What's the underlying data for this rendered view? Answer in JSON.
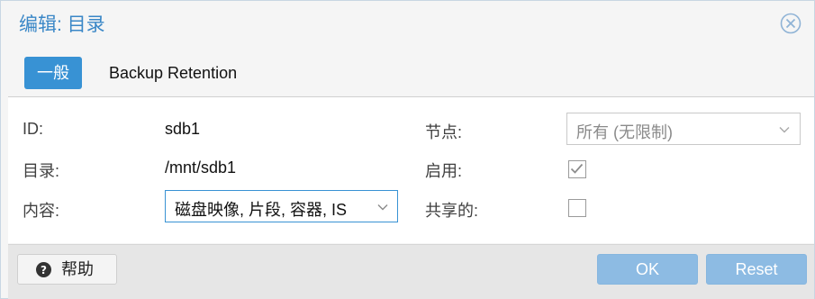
{
  "dialog": {
    "title": "编辑: 目录",
    "close_icon": "close-icon"
  },
  "tabs": [
    {
      "label": "一般",
      "active": true
    },
    {
      "label": "Backup Retention",
      "active": false
    }
  ],
  "form": {
    "id": {
      "label": "ID:",
      "value": "sdb1"
    },
    "directory": {
      "label": "目录:",
      "value": "/mnt/sdb1"
    },
    "content": {
      "label": "内容:",
      "value": "磁盘映像, 片段, 容器, IS"
    },
    "nodes": {
      "label": "节点:",
      "value": "所有 (无限制)"
    },
    "enabled": {
      "label": "启用:",
      "checked": true
    },
    "shared": {
      "label": "共享的:",
      "checked": false
    }
  },
  "footer": {
    "help_label": "帮助",
    "ok_label": "OK",
    "reset_label": "Reset"
  },
  "colors": {
    "accent": "#3892d4",
    "title": "#3a87c7",
    "disabled_button": "#8dbbe3"
  }
}
